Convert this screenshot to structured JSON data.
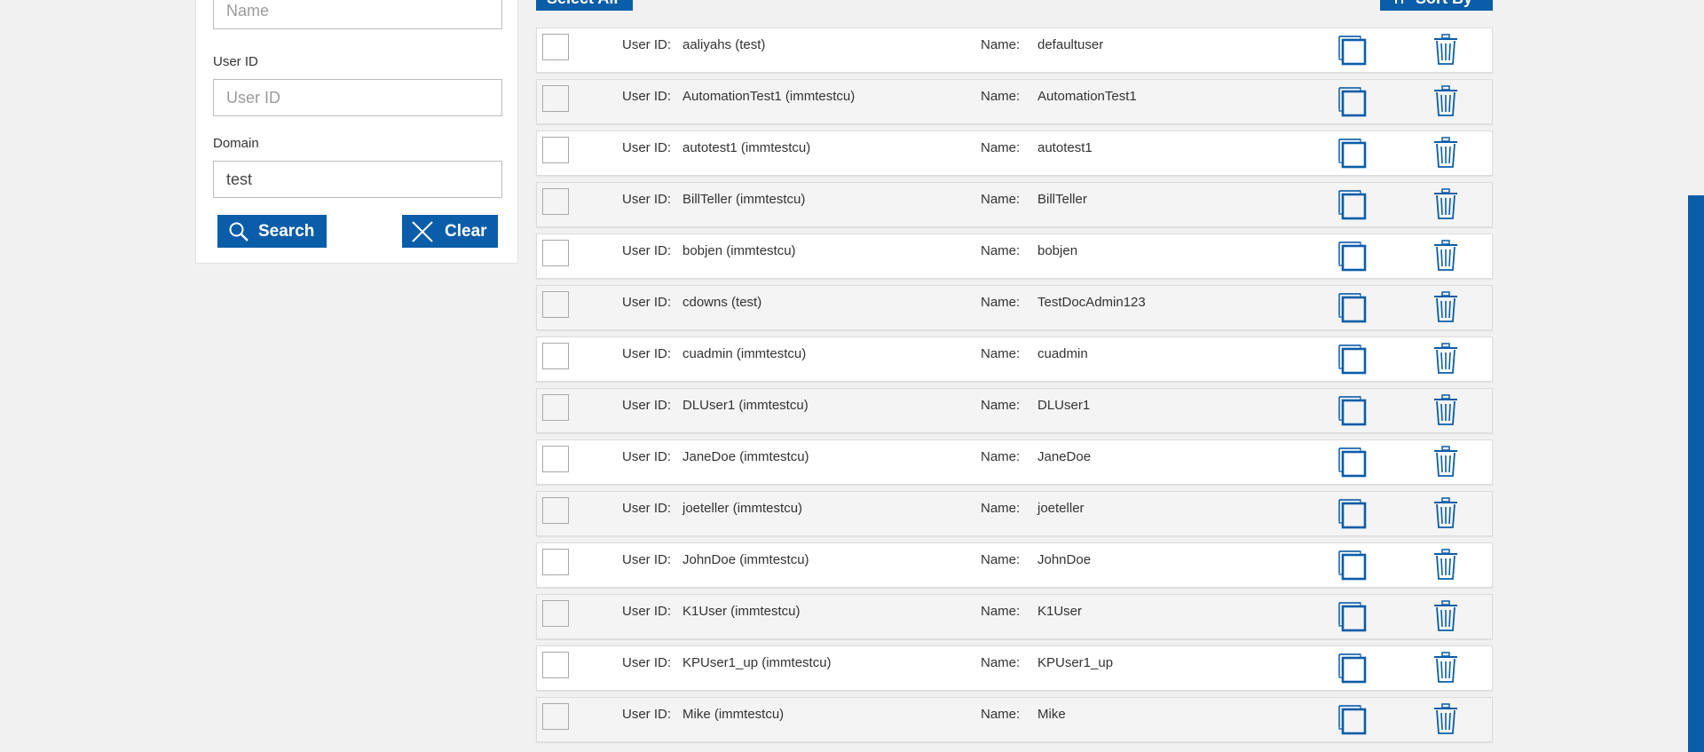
{
  "search_panel": {
    "name_field": {
      "value": "",
      "placeholder": "Name"
    },
    "userid_field": {
      "label": "User ID",
      "value": "",
      "placeholder": "User ID"
    },
    "domain_field": {
      "label": "Domain",
      "value": "test",
      "placeholder": ""
    },
    "search_button": {
      "label": "Search",
      "icon": "search-icon"
    },
    "clear_button": {
      "label": "Clear",
      "icon": "close-icon"
    }
  },
  "toolbar": {
    "select_all_label": "Select All",
    "sort_by_label": "Sort By"
  },
  "list": {
    "userid_label": "User ID:",
    "name_label": "Name:",
    "rows": [
      {
        "user_id": "aaliyahs (test)",
        "name": "defaultuser"
      },
      {
        "user_id": "AutomationTest1 (immtestcu)",
        "name": "AutomationTest1"
      },
      {
        "user_id": "autotest1 (immtestcu)",
        "name": "autotest1"
      },
      {
        "user_id": "BillTeller (immtestcu)",
        "name": "BillTeller"
      },
      {
        "user_id": "bobjen (immtestcu)",
        "name": "bobjen"
      },
      {
        "user_id": "cdowns (test)",
        "name": "TestDocAdmin123"
      },
      {
        "user_id": "cuadmin (immtestcu)",
        "name": "cuadmin"
      },
      {
        "user_id": "DLUser1 (immtestcu)",
        "name": "DLUser1"
      },
      {
        "user_id": "JaneDoe (immtestcu)",
        "name": "JaneDoe"
      },
      {
        "user_id": "joeteller (immtestcu)",
        "name": "joeteller"
      },
      {
        "user_id": "JohnDoe (immtestcu)",
        "name": "JohnDoe"
      },
      {
        "user_id": "K1User (immtestcu)",
        "name": "K1User"
      },
      {
        "user_id": "KPUser1_up (immtestcu)",
        "name": "KPUser1_up"
      },
      {
        "user_id": "Mike (immtestcu)",
        "name": "Mike"
      }
    ]
  },
  "colors": {
    "accent": "#0a5da8",
    "background": "#f1f1f1"
  }
}
